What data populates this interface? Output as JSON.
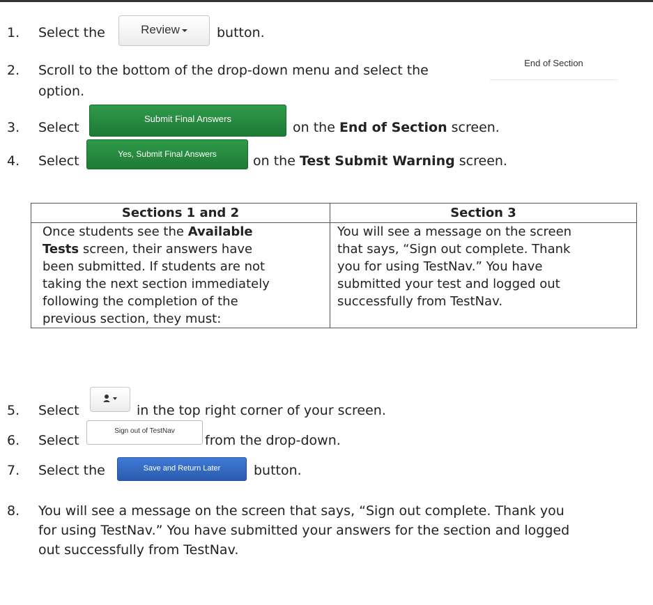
{
  "steps": [
    {
      "num": "1.",
      "pre": "Select the",
      "post": "button."
    },
    {
      "num": "2.",
      "pre": "Scroll to the bottom of the drop-down menu and select the",
      "line2": "option."
    },
    {
      "num": "3.",
      "pre": "Select",
      "post_a": "on the ",
      "post_b": "End of Section",
      "post_c": " screen."
    },
    {
      "num": "4.",
      "pre": "Select",
      "post_a": "on the ",
      "post_b": "Test Submit Warning",
      "post_c": " screen."
    },
    {
      "num": "5.",
      "pre": "Select",
      "post": "in the top right corner of your screen."
    },
    {
      "num": "6.",
      "pre": "Select",
      "post": "from the drop-down."
    },
    {
      "num": "7.",
      "pre": "Select the",
      "post": "button."
    },
    {
      "num": "8.",
      "lines": [
        "You will see a message on the screen that says, “Sign out complete. Thank you",
        "for using TestNav.” You have submitted your answers for the section and logged",
        "out successfully from TestNav."
      ]
    }
  ],
  "buttons": {
    "review": "Review",
    "end_of_section": "End of Section",
    "submit_final": "Submit Final Answers",
    "yes_submit_final": "Yes, Submit Final Answers",
    "user_menu_icon": "user-icon",
    "sign_out": "Sign out of TestNav",
    "save_return": "Save and Return Later"
  },
  "table": {
    "headers": [
      "Sections 1 and 2",
      "Section 3"
    ],
    "col1": {
      "l1_pre": "Once students see the ",
      "l1_b": "Available",
      "l2_b": "Tests",
      "l2_post": " screen, their answers have",
      "l3": "been submitted. If students are not",
      "l4": "taking the next section immediately",
      "l5": "following the completion of the",
      "l6": "previous section, they must:"
    },
    "col2": [
      "You will see a message on the screen",
      "that says, “Sign out complete. Thank",
      "you for using TestNav.” You have",
      "submitted your test and logged out",
      "successfully from TestNav."
    ]
  },
  "colors": {
    "green": "#1e7a34",
    "blue": "#2a5cae",
    "rule": "#333333"
  }
}
